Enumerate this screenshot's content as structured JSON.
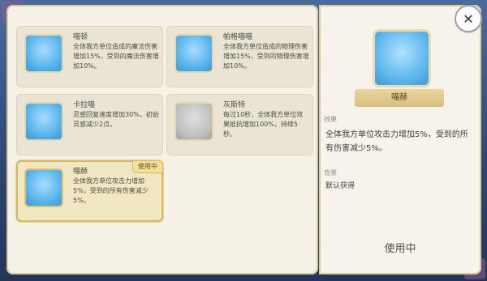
{
  "cards": [
    {
      "name": "喵顿",
      "desc": "全体我方单位造成的魔法伤害增加15%，受到的魔法伤害增加10%。",
      "style": "blue"
    },
    {
      "name": "帕格喵喵",
      "desc": "全体我方单位造成的物理伤害增加15%，受到的物理伤害增加10%。",
      "style": "blue"
    },
    {
      "name": "卡拉喵",
      "desc": "灵感回复速度增加30%，初始灵感减少2点。",
      "style": "blue"
    },
    {
      "name": "灰斯特",
      "desc": "每过10秒，全体我方单位效果抵抗增加100%，持续5秒。",
      "style": "gray"
    },
    {
      "name": "喵赫",
      "desc": "全体我方单位攻击力增加5%，受到的所有伤害减少5%。",
      "style": "red"
    }
  ],
  "badge": "使用中",
  "detail": {
    "name": "喵赫",
    "effect_label": "效果",
    "effect_text": "全体我方单位攻击力增加5%，受到的所有伤害减少5%。",
    "bg_label": "背景",
    "bg_text": "默认获得",
    "status": "使用中"
  },
  "icons": {
    "close": "close-icon"
  }
}
